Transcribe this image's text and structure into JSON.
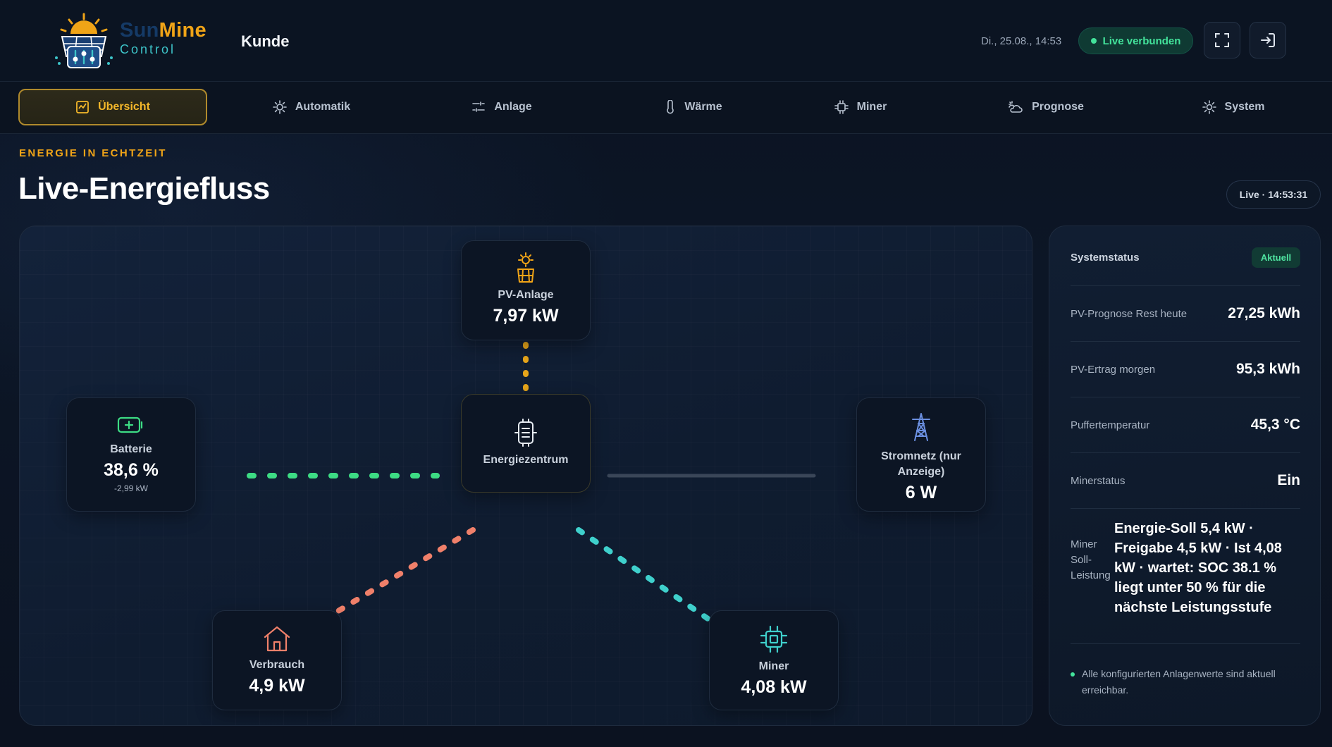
{
  "header": {
    "brand_sun": "Sun",
    "brand_mine": "Mine",
    "brand_sub": "Control",
    "user": "Kunde",
    "datetime": "Di., 25.08., 14:53",
    "live_status": "Live verbunden"
  },
  "nav": {
    "tabs": [
      {
        "label": "Übersicht",
        "icon": "chart-icon",
        "active": true
      },
      {
        "label": "Automatik",
        "icon": "sun-gear-icon",
        "active": false
      },
      {
        "label": "Anlage",
        "icon": "sliders-icon",
        "active": false
      },
      {
        "label": "Wärme",
        "icon": "thermometer-icon",
        "active": false
      },
      {
        "label": "Miner",
        "icon": "chip-icon",
        "active": false
      },
      {
        "label": "Prognose",
        "icon": "weather-icon",
        "active": false
      },
      {
        "label": "System",
        "icon": "gear-icon",
        "active": false
      }
    ]
  },
  "section": {
    "eyebrow": "ENERGIE IN ECHTZEIT",
    "title": "Live-Energiefluss",
    "live_time": "Live · 14:53:31"
  },
  "flow": {
    "pv": {
      "label": "PV-Anlage",
      "value": "7,97 kW"
    },
    "battery": {
      "label": "Batterie",
      "value": "38,6 %",
      "sub": "-2,99 kW"
    },
    "center": {
      "label": "Energiezentrum"
    },
    "grid": {
      "label": "Stromnetz (nur Anzeige)",
      "value": "6 W"
    },
    "consumption": {
      "label": "Verbrauch",
      "value": "4,9 kW"
    },
    "miner": {
      "label": "Miner",
      "value": "4,08 kW"
    }
  },
  "status": {
    "title": "Systemstatus",
    "badge": "Aktuell",
    "rows": [
      {
        "key": "PV-Prognose Rest heute",
        "value": "27,25 kWh"
      },
      {
        "key": "PV-Ertrag morgen",
        "value": "95,3 kWh"
      },
      {
        "key": "Puffertemperatur",
        "value": "45,3 °C"
      },
      {
        "key": "Minerstatus",
        "value": "Ein"
      },
      {
        "key": "Miner Soll-Leistung",
        "value": "Energie-Soll 5,4 kW · Freigabe 4,5 kW · Ist 4,08 kW · wartet: SOC 38.1 % liegt unter 50 % für die nächste Leistungsstufe"
      }
    ],
    "note": "Alle konfigurierten Anlagenwerte sind aktuell erreichbar."
  },
  "colors": {
    "accent": "#f0a417",
    "live_green": "#43e39b",
    "battery_flow": "#3ddc84",
    "consumption_flow": "#f0806a",
    "miner_flow": "#3fd0cc",
    "pv_flow": "#e6a51a"
  }
}
